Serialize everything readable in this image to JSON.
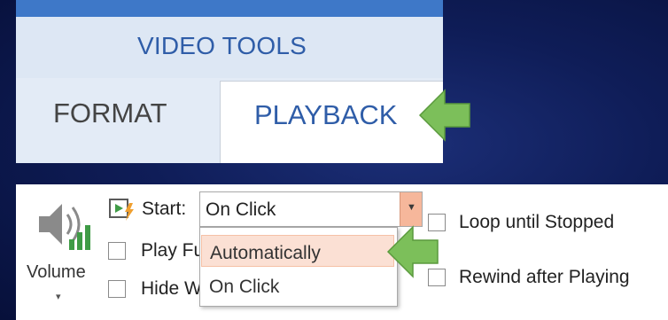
{
  "ribbon": {
    "contextual_group": "VIDEO TOOLS",
    "tabs": [
      {
        "label": "FORMAT",
        "active": false
      },
      {
        "label": "PLAYBACK",
        "active": true
      }
    ]
  },
  "playback": {
    "volume": {
      "label": "Volume",
      "icon": "speaker-volume-icon",
      "caret": "▾"
    },
    "start": {
      "icon": "play-lightning-icon",
      "label": "Start:",
      "selected": "On Click",
      "options": [
        "Automatically",
        "On Click"
      ],
      "highlighted_option": "Automatically"
    },
    "checkboxes": {
      "play_full_screen": {
        "label": "Play Fu",
        "checked": false
      },
      "hide_while_not_playing": {
        "label": "Hide W",
        "checked": false
      },
      "loop_until_stopped": {
        "label": "Loop until Stopped",
        "checked": false
      },
      "rewind_after_playing": {
        "label": "Rewind after Playing",
        "checked": false
      }
    }
  },
  "colors": {
    "accent_blue": "#2f5da8",
    "ribbon_bar": "#3e78c8",
    "dropdown_highlight": "#fbe0d4",
    "select_button": "#f6b79b",
    "callout_arrow": "#7cbf5a",
    "background": "#0f1d58"
  }
}
